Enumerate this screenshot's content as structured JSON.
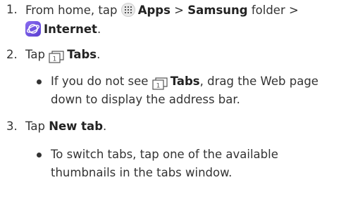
{
  "steps": [
    {
      "num": "1.",
      "line1": {
        "pre": "From home, tap ",
        "b1": "Apps",
        "mid1": " > ",
        "b2": "Samsung",
        "post": " folder >"
      },
      "line2": {
        "b": "Internet",
        "post": "."
      }
    },
    {
      "num": "2.",
      "pre": "Tap ",
      "b": "Tabs",
      "post": "."
    },
    {
      "num": "3.",
      "pre": "Tap ",
      "b": "New tab",
      "post": "."
    }
  ],
  "bullets": [
    {
      "line1": {
        "pre": "If you do not see ",
        "b": "Tabs",
        "post": ", drag the Web page"
      },
      "line2": "down to display the address bar."
    },
    {
      "line1": "To switch tabs, tap one of the available",
      "line2": "thumbnails in the tabs window."
    }
  ],
  "icons": {
    "apps": "apps-grid-icon",
    "internet": "samsung-internet-icon",
    "tabs": "tabs-icon"
  },
  "tabs_icon_digit": "1",
  "colors": {
    "text": "#333333",
    "internet_icon": "#6a4fe0"
  }
}
